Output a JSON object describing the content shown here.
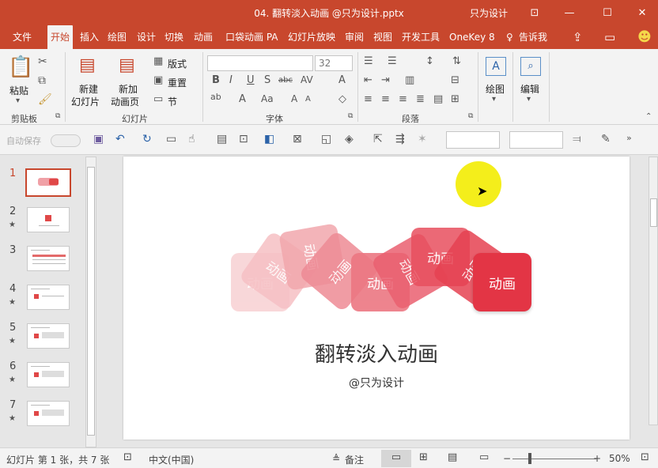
{
  "window": {
    "title": "04. 翻转淡入动画 @只为设计.pptx",
    "account": "只为设计"
  },
  "tabs": [
    "文件",
    "开始",
    "插入",
    "绘图",
    "设计",
    "切换",
    "动画",
    "口袋动画 PA",
    "幻灯片放映",
    "审阅",
    "视图",
    "开发工具",
    "OneKey 8",
    "告诉我"
  ],
  "ribbon": {
    "clipboard": {
      "paste": "粘贴",
      "group": "剪贴板"
    },
    "slides": {
      "new_line1": "新建",
      "new_line2": "幻灯片",
      "reuse_line1": "新加",
      "reuse_line2": "动画页",
      "layout": "版式",
      "reset": "重置",
      "section": "节",
      "group": "幻灯片"
    },
    "font": {
      "font_name": "",
      "font_size": "32",
      "group": "字体"
    },
    "paragraph": {
      "group": "段落"
    },
    "drawing": {
      "label": "绘图"
    },
    "editing": {
      "label": "编辑"
    }
  },
  "qat": {
    "autosave": "自动保存"
  },
  "thumbnails": [
    {
      "num": "1",
      "star": ""
    },
    {
      "num": "2",
      "star": "★"
    },
    {
      "num": "3",
      "star": ""
    },
    {
      "num": "4",
      "star": "★"
    },
    {
      "num": "5",
      "star": "★"
    },
    {
      "num": "6",
      "star": "★"
    },
    {
      "num": "7",
      "star": "★"
    }
  ],
  "slide": {
    "title": "翻转淡入动画",
    "subtitle": "@只为设计",
    "tile_text": "动画",
    "tile_colors": [
      "#f7c9cb",
      "#f3a9ad",
      "#ef8c94",
      "#ec6e7b",
      "#e9566a",
      "#e84456",
      "#e53a48"
    ]
  },
  "status": {
    "slide_info": "幻灯片 第 1 张，共 7 张",
    "language": "中文(中国)",
    "notes": "备注",
    "zoom": "50%"
  }
}
